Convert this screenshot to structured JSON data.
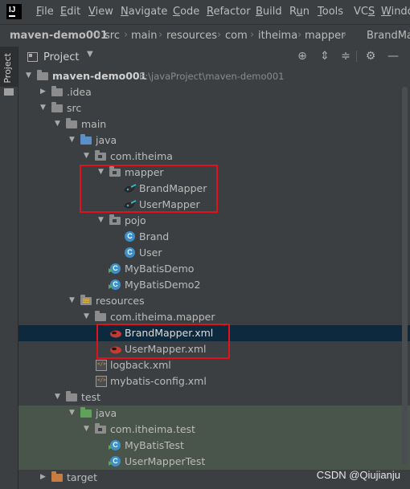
{
  "menubar": {
    "items": [
      "File",
      "Edit",
      "View",
      "Navigate",
      "Code",
      "Refactor",
      "Build",
      "Run",
      "Tools",
      "VCS",
      "Windo"
    ],
    "mnemonics": [
      "F",
      "E",
      "V",
      "N",
      "C",
      "R",
      "B",
      "u",
      "T",
      "S",
      "W"
    ]
  },
  "breadcrumb": {
    "items": [
      "maven-demo001",
      "src",
      "main",
      "resources",
      "com",
      "itheima",
      "mapper",
      "BrandMa"
    ]
  },
  "side_tab": {
    "label": "Project"
  },
  "panel": {
    "title": "Project"
  },
  "tree": [
    {
      "label": "maven-demo001",
      "path": "E:\\javaProject\\maven-demo001"
    },
    {
      "label": ".idea"
    },
    {
      "label": "src"
    },
    {
      "label": "main"
    },
    {
      "label": "java"
    },
    {
      "label": "com.itheima"
    },
    {
      "label": "mapper"
    },
    {
      "label": "BrandMapper"
    },
    {
      "label": "UserMapper"
    },
    {
      "label": "pojo"
    },
    {
      "label": "Brand"
    },
    {
      "label": "User"
    },
    {
      "label": "MyBatisDemo"
    },
    {
      "label": "MyBatisDemo2"
    },
    {
      "label": "resources"
    },
    {
      "label": "com.itheima.mapper"
    },
    {
      "label": "BrandMapper.xml"
    },
    {
      "label": "UserMapper.xml"
    },
    {
      "label": "logback.xml"
    },
    {
      "label": "mybatis-config.xml"
    },
    {
      "label": "test"
    },
    {
      "label": "java"
    },
    {
      "label": "com.itheima.test"
    },
    {
      "label": "MyBatisTest"
    },
    {
      "label": "UserMapperTest"
    },
    {
      "label": "target"
    }
  ],
  "watermark": "CSDN @Qiujianju",
  "colors": {
    "background": "#3c3f41",
    "selection": "#0d293e",
    "test_folder_bg": "#49544a",
    "annotation_red": "#e0121c"
  }
}
